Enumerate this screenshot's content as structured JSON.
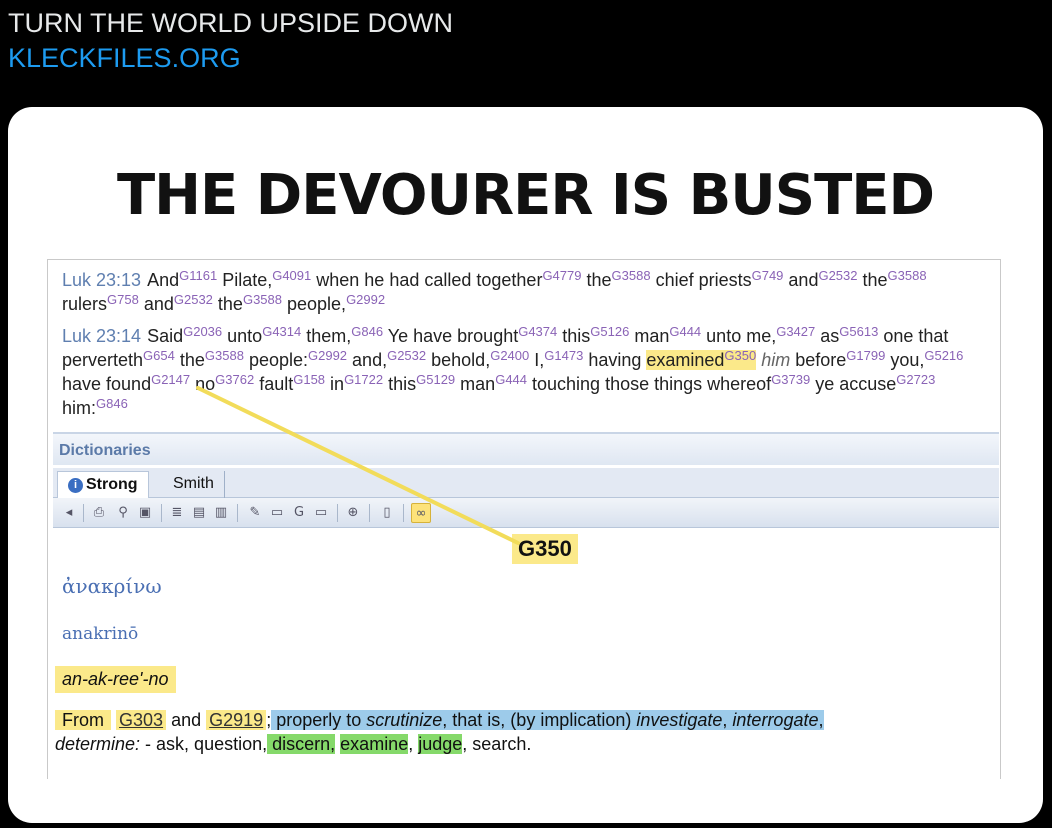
{
  "post": {
    "title": "TURN THE WORLD UPSIDE DOWN",
    "link": "KLECKFILES.ORG"
  },
  "headline": "THE DEVOURER IS BUSTED",
  "verses": [
    {
      "ref": "Luk 23:13",
      "tokens": [
        {
          "w": "And",
          "s": "G1161"
        },
        {
          "w": " Pilate,",
          "s": "G4091"
        },
        {
          "w": " when he had called together",
          "s": "G4779"
        },
        {
          "w": " the",
          "s": "G3588"
        },
        {
          "w": " chief priests",
          "s": "G749"
        },
        {
          "w": " and",
          "s": "G2532"
        },
        {
          "w": " the",
          "s": "G3588"
        },
        {
          "w": " rulers",
          "s": "G758"
        },
        {
          "w": " and",
          "s": "G2532"
        },
        {
          "w": " the",
          "s": "G3588"
        },
        {
          "w": " people,",
          "s": "G2992"
        }
      ]
    },
    {
      "ref": "Luk 23:14",
      "tokens": [
        {
          "w": "Said",
          "s": "G2036"
        },
        {
          "w": " unto",
          "s": "G4314"
        },
        {
          "w": " them,",
          "s": "G846"
        },
        {
          "w": " Ye have brought",
          "s": "G4374"
        },
        {
          "w": " this",
          "s": "G5126"
        },
        {
          "w": " man",
          "s": "G444"
        },
        {
          "w": " unto me,",
          "s": "G3427"
        },
        {
          "w": " as",
          "s": "G5613"
        },
        {
          "w": " one that perverteth",
          "s": "G654"
        },
        {
          "w": " the",
          "s": "G3588"
        },
        {
          "w": " people:",
          "s": "G2992"
        },
        {
          "w": " and,",
          "s": "G2532"
        },
        {
          "w": " behold,",
          "s": "G2400"
        },
        {
          "w": " I,",
          "s": "G1473"
        },
        {
          "w": " having ",
          "s": ""
        },
        {
          "w": "examined",
          "s": "G350",
          "hl": true
        },
        {
          "w": " him",
          "s": "",
          "it": true
        },
        {
          "w": " before",
          "s": "G1799"
        },
        {
          "w": " you,",
          "s": "G5216"
        },
        {
          "w": " have found",
          "s": "G2147"
        },
        {
          "w": " no",
          "s": "G3762"
        },
        {
          "w": " fault",
          "s": "G158"
        },
        {
          "w": " in",
          "s": "G1722"
        },
        {
          "w": " this",
          "s": "G5129"
        },
        {
          "w": " man",
          "s": "G444"
        },
        {
          "w": " touching those things whereof",
          "s": "G3739"
        },
        {
          "w": " ye accuse",
          "s": "G2723"
        },
        {
          "w": " him:",
          "s": "G846"
        }
      ]
    }
  ],
  "panel": {
    "title": "Dictionaries",
    "tabs": [
      "Strong",
      "Smith"
    ]
  },
  "toolbar_icons": [
    "back-icon",
    "print-icon",
    "find-icon",
    "copy-icon",
    "notes-icon",
    "paste-icon",
    "clipboard-icon",
    "edit-icon",
    "format-icon",
    "god-icon",
    "strike-icon",
    "zoom-icon",
    "book-icon",
    "link-icon"
  ],
  "entry": {
    "number": "G350",
    "greek": "ἀνακρίνω",
    "translit": "anakrinō",
    "pron": "an-ak-ree'-no",
    "from": "From",
    "link1": "G303",
    "and": "and",
    "link2": "G2919",
    "semicolon": ";",
    "def_1": " properly to ",
    "scrutinize": "scrutinize",
    "def_2": ", that is, (by implication) ",
    "investigate": "investigate",
    "comma": ", ",
    "interrogate": "interrogate",
    "comma2": ",",
    "determine": "determine:",
    "def_3": " - ask, question,",
    "discern": " discern,",
    "examine": " examine",
    "comma3": ",",
    "judge": " judge",
    "search": ", search."
  }
}
